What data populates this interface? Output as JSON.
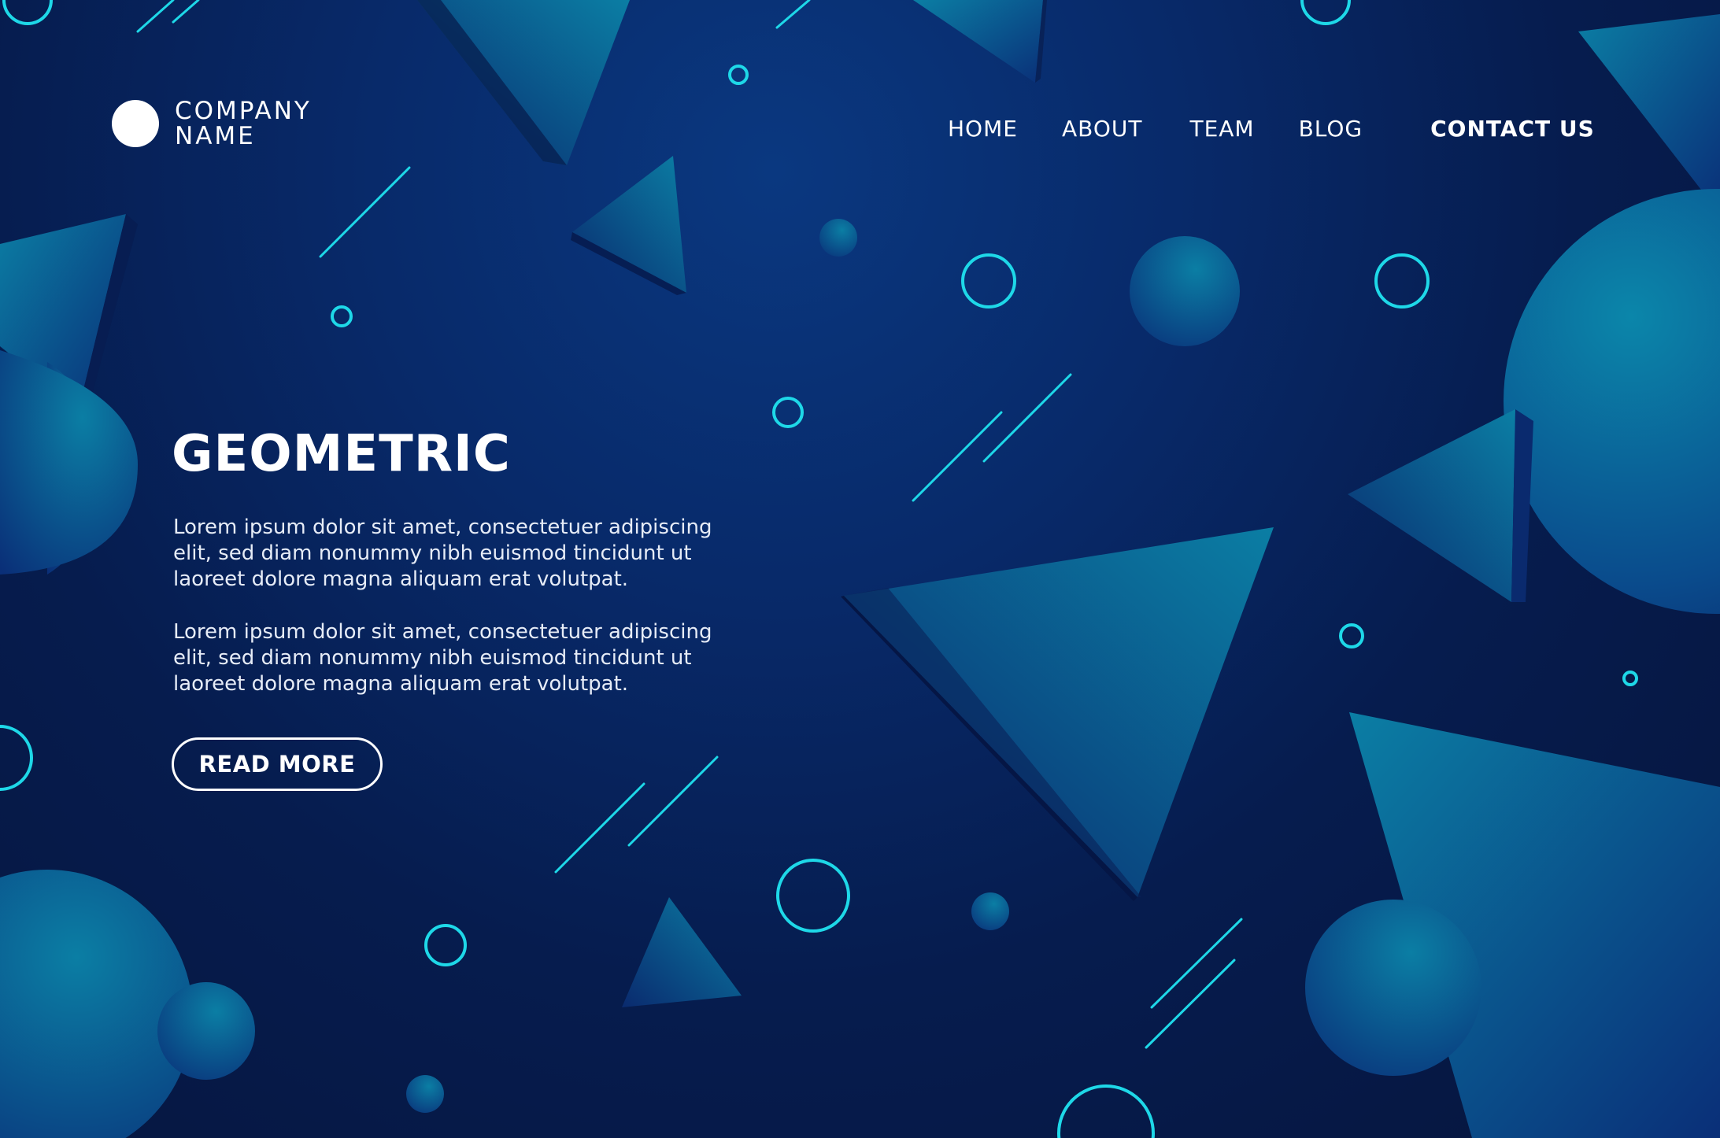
{
  "logo": {
    "line1": "COMPANY",
    "line2": "NAME",
    "mark_icon": "white-circle-logo-icon"
  },
  "nav": {
    "items": [
      {
        "label": "HOME"
      },
      {
        "label": "ABOUT"
      },
      {
        "label": "TEAM"
      },
      {
        "label": "BLOG"
      },
      {
        "label": "CONTACT US"
      }
    ]
  },
  "hero": {
    "title": "GEOMETRIC",
    "paragraph1": "Lorem ipsum dolor sit amet, consectetuer adipiscing elit, sed diam nonummy nibh euismod tincidunt ut laoreet dolore magna aliquam erat volutpat.",
    "paragraph2": "Lorem ipsum dolor sit amet, consectetuer adipiscing elit, sed diam nonummy nibh euismod tincidunt ut laoreet dolore magna aliquam erat volutpat.",
    "button_label": "READ MORE"
  },
  "colors": {
    "background_dark": "#06153d",
    "background_mid": "#082a6a",
    "accent_cyan": "#1ed8e8",
    "shape_teal": "#0a6f96",
    "text": "#ffffff"
  }
}
